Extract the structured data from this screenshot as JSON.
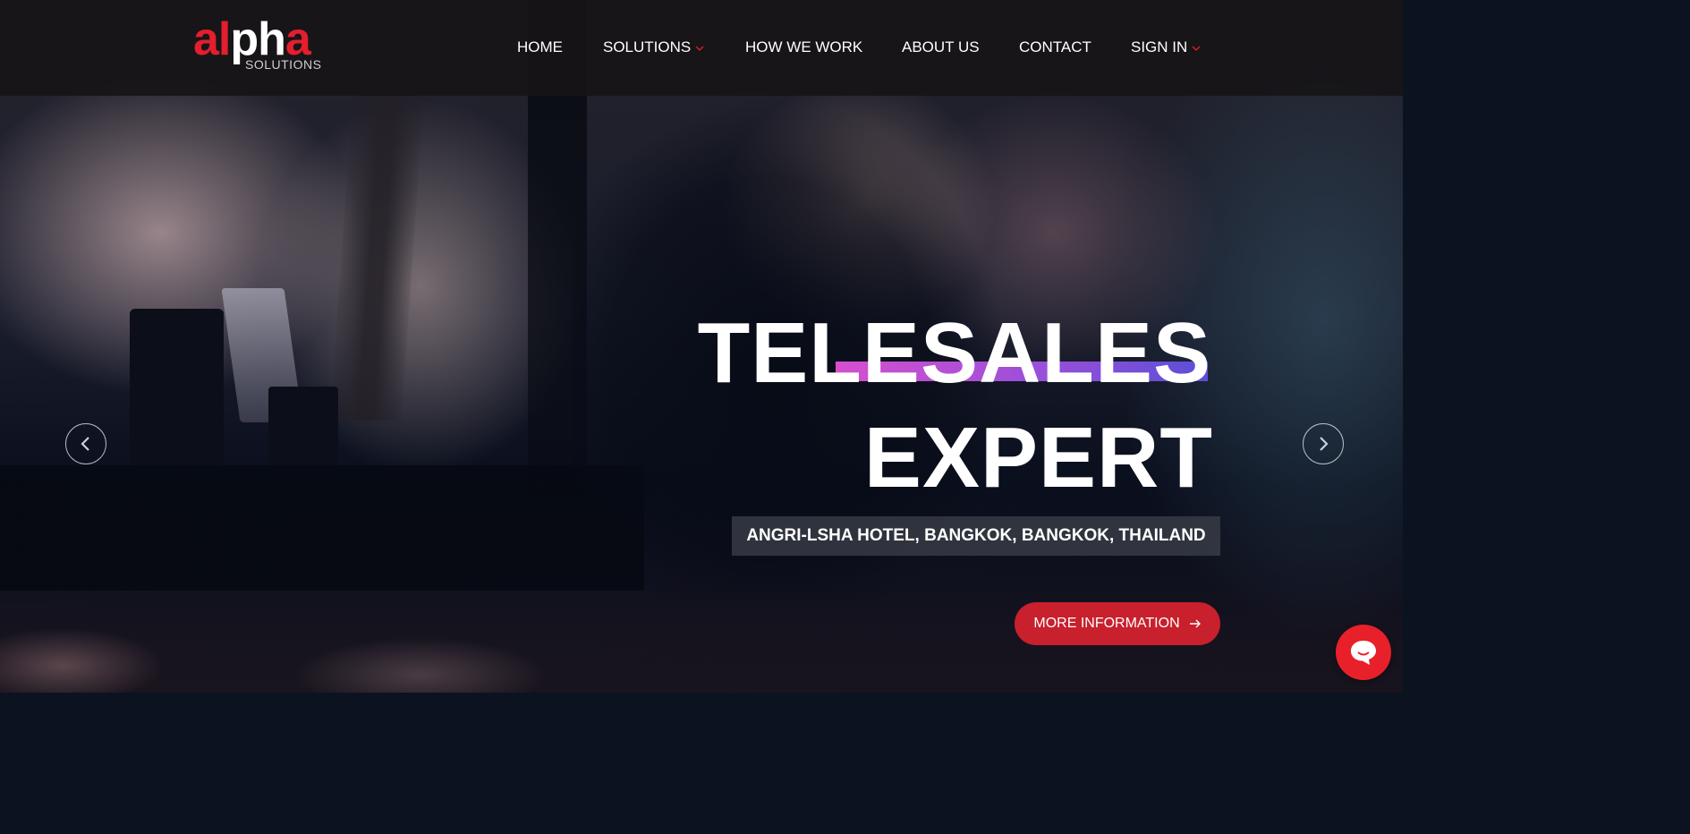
{
  "logo": {
    "word_red_1": "al",
    "word_white": "ph",
    "word_red_2": "a",
    "tagline": "SOLUTIONS"
  },
  "nav": {
    "home": "HOME",
    "solutions": "SOLUTIONS",
    "how_we_work": "HOW WE WORK",
    "about_us": "ABOUT US",
    "contact": "CONTACT",
    "sign_in": "SIGN IN"
  },
  "hero": {
    "title_line1": "TELESALES",
    "title_line2": "EXPERT",
    "location": "ANGRI-LSHA HOTEL, BANGKOK, BANGKOK, THAILAND",
    "cta_label": "MORE INFORMATION"
  },
  "colors": {
    "brand_red": "#e31e2d",
    "cta_red": "#c8202c",
    "underline_gradient": [
      "#d64fcf",
      "#9a4fd9",
      "#5a4fd6"
    ],
    "chat_red": "#e8202a"
  },
  "icons": {
    "dropdown": "chevron-down-icon",
    "prev": "chevron-left-icon",
    "next": "chevron-right-icon",
    "cta_arrow": "arrow-right-icon",
    "chat": "chat-bubble-icon"
  }
}
